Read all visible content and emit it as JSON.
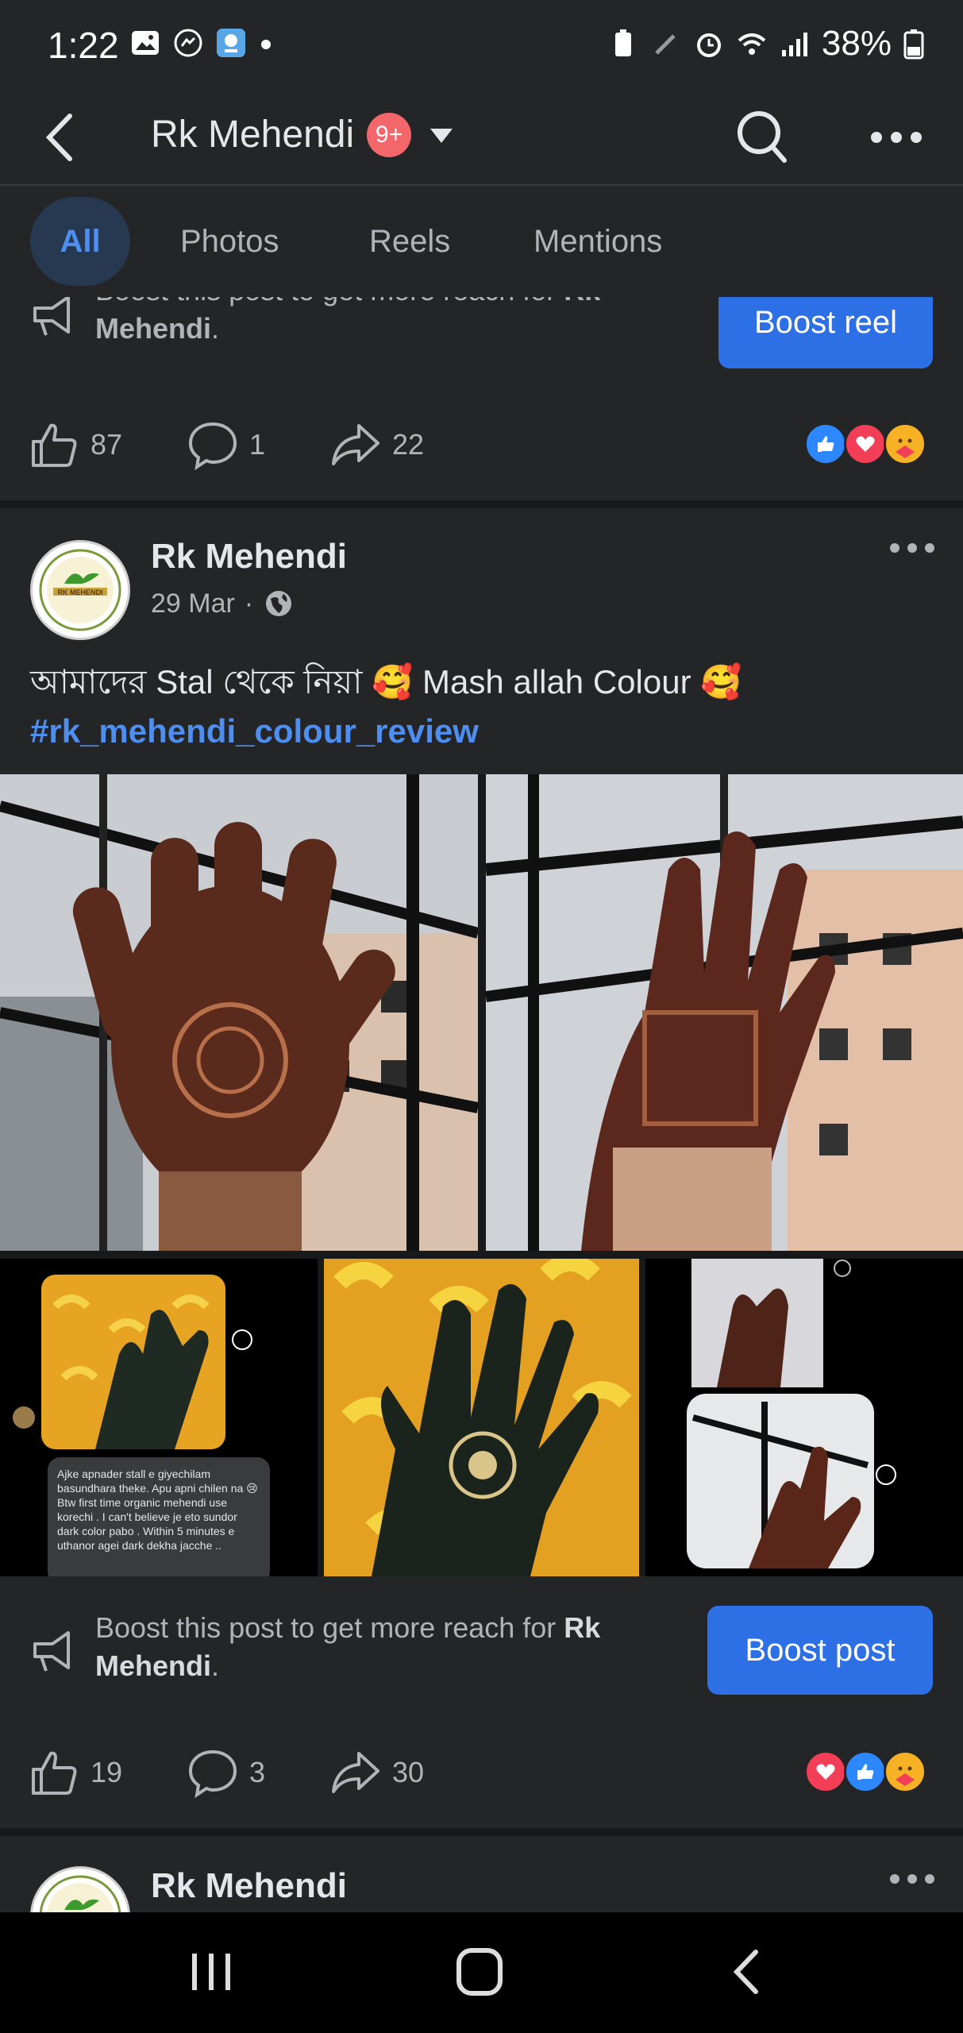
{
  "status_bar": {
    "time": "1:22",
    "battery": "38%"
  },
  "top_bar": {
    "title": "Rk Mehendi",
    "badge": "9+"
  },
  "tabs": [
    {
      "label": "All"
    },
    {
      "label": "Photos"
    },
    {
      "label": "Reels"
    },
    {
      "label": "Mentions"
    }
  ],
  "boost_reel": {
    "text_prefix": "Boost this post to get more reach for ",
    "page_name": "Rk Mehendi",
    "text_suffix": ".",
    "button": "Boost reel"
  },
  "post1_actions": {
    "likes": "87",
    "comments": "1",
    "shares": "22"
  },
  "post2": {
    "author": "Rk Mehendi",
    "date": "29 Mar",
    "separator": "·",
    "caption": "আমাদের Stal থেকে নিয়া 🥰 Mash allah Colour 🥰",
    "hashtag": "#rk_mehendi_colour_review",
    "avatar_text": "RK MEHENDI",
    "chat_text": "Ajke apnader stall e giyechilam basundhara theke. Apu apni chilen na 😢 Btw first time organic mehendi use korechi . I can't believe je eto sundor dark color pabo . Within 5 minutes e uthanor agei dark dekha jacche ..",
    "boost": {
      "text_prefix": "Boost this post to get more reach for ",
      "page_name": "Rk Mehendi",
      "text_suffix": ".",
      "button": "Boost post"
    },
    "actions": {
      "likes": "19",
      "comments": "3",
      "shares": "30"
    }
  },
  "post3": {
    "author": "Rk Mehendi"
  },
  "colors": {
    "background": "#242526",
    "accent": "#2d6fe5",
    "link": "#4d8ef0",
    "badge": "#f3676a"
  }
}
